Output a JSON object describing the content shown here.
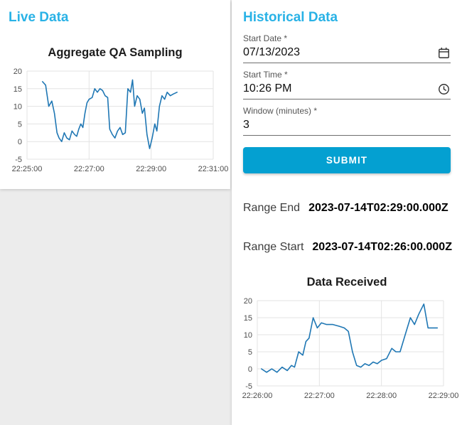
{
  "colors": {
    "accent": "#29b2e6",
    "button_bg": "#04a0d1",
    "chart_line": "#1f77b4"
  },
  "live_panel": {
    "title": "Live Data"
  },
  "historical_panel": {
    "title": "Historical Data",
    "form": {
      "start_date": {
        "label": "Start Date *",
        "value": "07/13/2023",
        "icon": "calendar-icon"
      },
      "start_time": {
        "label": "Start Time *",
        "value": "10:26 PM",
        "icon": "clock-icon"
      },
      "window_minutes": {
        "label": "Window (minutes) *",
        "value": "3"
      },
      "submit_label": "SUBMIT"
    },
    "range_end": {
      "label": "Range End",
      "value": "2023-07-14T02:29:00.000Z"
    },
    "range_start": {
      "label": "Range Start",
      "value": "2023-07-14T02:26:00.000Z"
    }
  },
  "chart_data": [
    {
      "type": "line",
      "title": "Aggregate QA Sampling",
      "xlabel": "",
      "ylabel": "",
      "grid": true,
      "legend": "none",
      "line_color": "#1f77b4",
      "ylim": [
        -5,
        20
      ],
      "yticks": [
        -5,
        0,
        5,
        10,
        15,
        20
      ],
      "xlim": [
        0,
        360
      ],
      "x_unit": "seconds after 22:25:00",
      "xticks": [
        {
          "t": 0,
          "label": "22:25:00"
        },
        {
          "t": 120,
          "label": "22:27:00"
        },
        {
          "t": 240,
          "label": "22:29:00"
        },
        {
          "t": 360,
          "label": "22:31:00"
        }
      ],
      "points": [
        [
          30,
          17
        ],
        [
          36,
          16
        ],
        [
          42,
          10
        ],
        [
          48,
          11.5
        ],
        [
          53,
          8
        ],
        [
          58,
          2.5
        ],
        [
          62,
          1
        ],
        [
          67,
          0
        ],
        [
          72,
          2.5
        ],
        [
          77,
          1
        ],
        [
          82,
          0.5
        ],
        [
          87,
          3
        ],
        [
          92,
          2
        ],
        [
          96,
          1.5
        ],
        [
          100,
          3.5
        ],
        [
          104,
          5
        ],
        [
          108,
          4
        ],
        [
          112,
          8
        ],
        [
          116,
          11
        ],
        [
          120,
          12
        ],
        [
          126,
          12.5
        ],
        [
          131,
          15
        ],
        [
          136,
          14
        ],
        [
          141,
          15
        ],
        [
          146,
          14.5
        ],
        [
          151,
          13
        ],
        [
          156,
          12.5
        ],
        [
          160,
          3.5
        ],
        [
          165,
          2
        ],
        [
          170,
          1
        ],
        [
          175,
          3
        ],
        [
          180,
          4
        ],
        [
          185,
          2
        ],
        [
          190,
          2.5
        ],
        [
          195,
          15
        ],
        [
          200,
          14
        ],
        [
          204,
          17.5
        ],
        [
          208,
          10
        ],
        [
          213,
          13
        ],
        [
          218,
          12
        ],
        [
          223,
          8
        ],
        [
          227,
          9.5
        ],
        [
          232,
          2
        ],
        [
          237,
          -2
        ],
        [
          242,
          1
        ],
        [
          247,
          5
        ],
        [
          251,
          3
        ],
        [
          256,
          10
        ],
        [
          261,
          13
        ],
        [
          266,
          12
        ],
        [
          271,
          14
        ],
        [
          277,
          13
        ],
        [
          283,
          13.5
        ],
        [
          290,
          14
        ]
      ]
    },
    {
      "type": "line",
      "title": "Data Received",
      "xlabel": "",
      "ylabel": "",
      "grid": true,
      "legend": "none",
      "line_color": "#1f77b4",
      "ylim": [
        -5,
        20
      ],
      "yticks": [
        -5,
        0,
        5,
        10,
        15,
        20
      ],
      "xlim": [
        0,
        180
      ],
      "x_unit": "seconds after 22:26:00",
      "xticks": [
        {
          "t": 0,
          "label": "22:26:00"
        },
        {
          "t": 60,
          "label": "22:27:00"
        },
        {
          "t": 120,
          "label": "22:28:00"
        },
        {
          "t": 180,
          "label": "22:29:00"
        }
      ],
      "points": [
        [
          4,
          0
        ],
        [
          9,
          -1
        ],
        [
          14,
          0
        ],
        [
          19,
          -1
        ],
        [
          24,
          0.5
        ],
        [
          29,
          -0.5
        ],
        [
          33,
          1
        ],
        [
          36,
          0.5
        ],
        [
          40,
          5
        ],
        [
          44,
          4
        ],
        [
          47,
          8
        ],
        [
          50,
          9
        ],
        [
          54,
          15
        ],
        [
          58,
          12
        ],
        [
          62,
          13.5
        ],
        [
          67,
          13
        ],
        [
          73,
          13
        ],
        [
          79,
          12.5
        ],
        [
          84,
          12
        ],
        [
          88,
          11
        ],
        [
          92,
          5
        ],
        [
          96,
          1
        ],
        [
          100,
          0.5
        ],
        [
          104,
          1.5
        ],
        [
          108,
          1
        ],
        [
          112,
          2
        ],
        [
          116,
          1.5
        ],
        [
          120,
          2.5
        ],
        [
          125,
          3
        ],
        [
          130,
          6
        ],
        [
          134,
          5
        ],
        [
          138,
          5
        ],
        [
          143,
          10
        ],
        [
          148,
          15
        ],
        [
          152,
          13
        ],
        [
          156,
          16
        ],
        [
          161,
          19
        ],
        [
          165,
          12
        ],
        [
          169,
          12
        ],
        [
          174,
          12
        ]
      ]
    }
  ]
}
